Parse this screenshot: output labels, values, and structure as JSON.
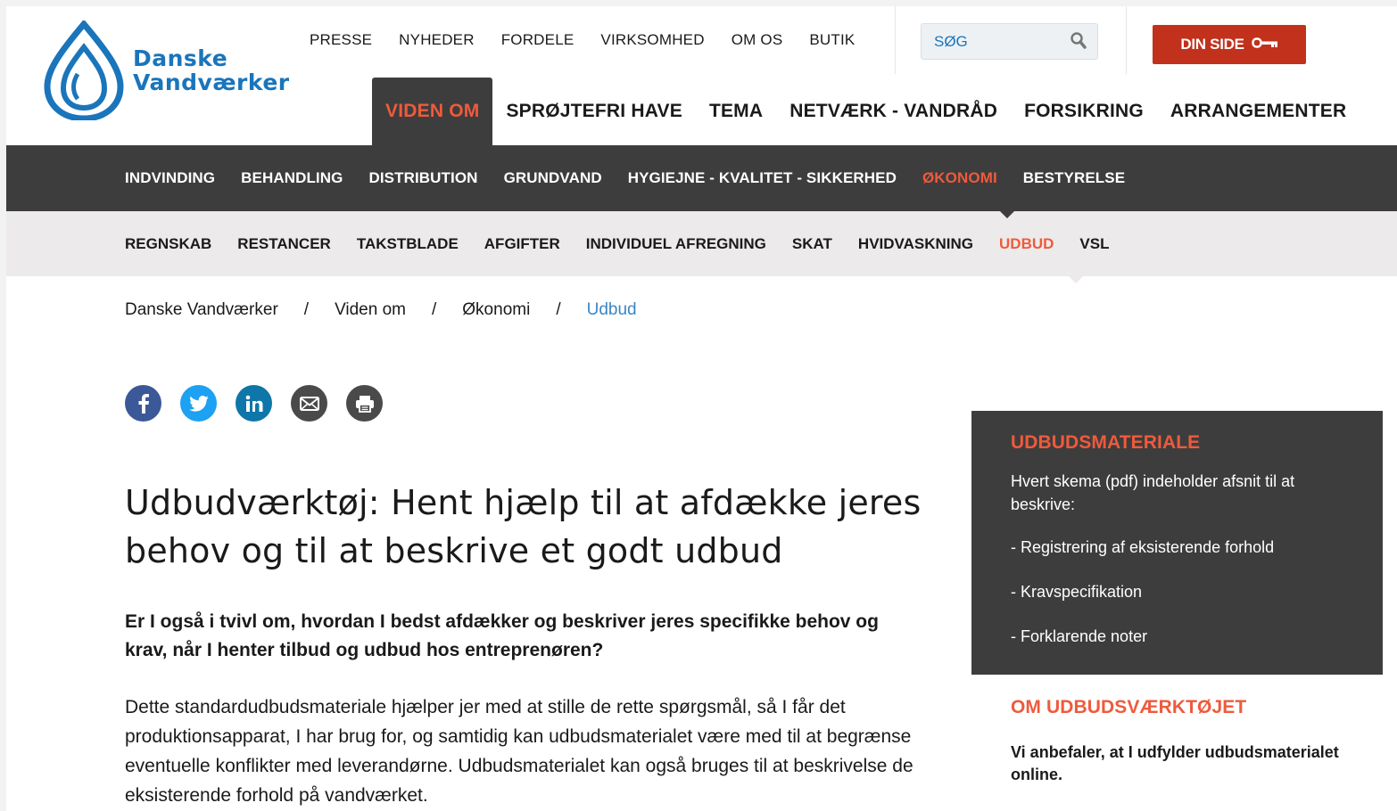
{
  "brand": {
    "line1": "Danske",
    "line2": "Vandværker"
  },
  "top_nav": [
    "PRESSE",
    "NYHEDER",
    "FORDELE",
    "VIRKSOMHED",
    "OM OS",
    "BUTIK"
  ],
  "search": {
    "placeholder": "SØG"
  },
  "din_side": "DIN SIDE",
  "main_nav": [
    {
      "label": "VIDEN OM",
      "active": true
    },
    {
      "label": "SPRØJTEFRI HAVE",
      "active": false
    },
    {
      "label": "TEMA",
      "active": false
    },
    {
      "label": "NETVÆRK - VANDRÅD",
      "active": false
    },
    {
      "label": "FORSIKRING",
      "active": false
    },
    {
      "label": "ARRANGEMENTER",
      "active": false
    }
  ],
  "sub_nav": [
    {
      "label": "INDVINDING"
    },
    {
      "label": "BEHANDLING"
    },
    {
      "label": "DISTRIBUTION"
    },
    {
      "label": "GRUNDVAND"
    },
    {
      "label": "HYGIEJNE - KVALITET - SIKKERHED"
    },
    {
      "label": "ØKONOMI",
      "active": true
    },
    {
      "label": "BESTYRELSE"
    }
  ],
  "sub_sub_nav": [
    {
      "label": "REGNSKAB"
    },
    {
      "label": "RESTANCER"
    },
    {
      "label": "TAKSTBLADE"
    },
    {
      "label": "AFGIFTER"
    },
    {
      "label": "INDIVIDUEL AFREGNING"
    },
    {
      "label": "SKAT"
    },
    {
      "label": "HVIDVASKNING"
    },
    {
      "label": "UDBUD",
      "active": true
    },
    {
      "label": "VSL"
    }
  ],
  "breadcrumb": {
    "items": [
      "Danske Vandværker",
      "Viden om",
      "Økonomi"
    ],
    "current": "Udbud",
    "separator": "/"
  },
  "article": {
    "title": "Udbudværktøj: Hent hjælp til at afdække jeres behov og til at beskrive et godt udbud",
    "lead": "Er I også i tvivl om, hvordan I bedst afdækker og beskriver jeres specifikke behov og krav, når I henter tilbud og udbud hos entreprenøren?",
    "body": "Dette standardudbudsmateriale hjælper jer med at stille de rette spørgsmål, så I får det produktionsapparat, I har brug for, og samtidig kan udbudsmaterialet være med til at begrænse eventuelle konflikter med leverandørne. Udbudsmaterialet kan også bruges til at beskrivelse de eksisterende forhold på vandværket."
  },
  "sidebar": {
    "box_title": "UDBUDSMATERIALE",
    "box_intro": "Hvert skema (pdf) indeholder afsnit til at beskrive:",
    "box_items": [
      "- Registrering af eksisterende forhold",
      "- Kravspecifikation",
      "- Forklarende noter"
    ],
    "section_title": "OM UDBUDSVÆRKTØJET",
    "section_text": "Vi anbefaler, at I udfylder udbudsmaterialet online."
  },
  "colors": {
    "brand_blue": "#1a75bb",
    "accent": "#ef5a3c",
    "dark_bar": "#3d3d3d",
    "button_red": "#c1311c"
  }
}
